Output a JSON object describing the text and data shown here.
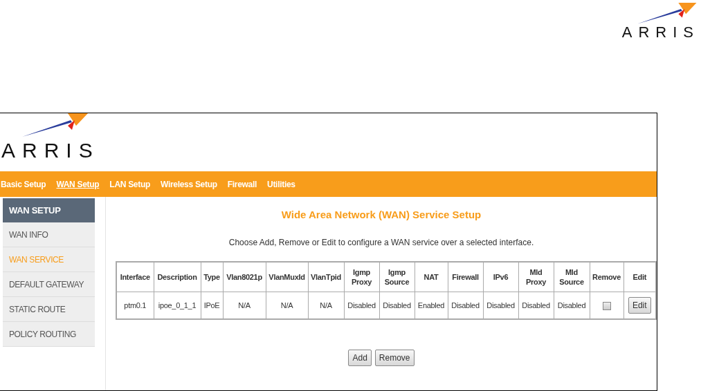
{
  "document_header": {
    "logo_text": "ARRIS"
  },
  "app_header": {
    "logo_text": "ARRIS"
  },
  "nav": [
    {
      "label": "Basic Setup",
      "selected": false
    },
    {
      "label": "WAN Setup",
      "selected": true
    },
    {
      "label": "LAN Setup",
      "selected": false
    },
    {
      "label": "Wireless Setup",
      "selected": false
    },
    {
      "label": "Firewall",
      "selected": false
    },
    {
      "label": "Utilities",
      "selected": false
    }
  ],
  "sidebar": {
    "title": "WAN SETUP",
    "items": [
      {
        "label": "WAN INFO",
        "selected": false
      },
      {
        "label": "WAN SERVICE",
        "selected": true
      },
      {
        "label": "DEFAULT GATEWAY",
        "selected": false
      },
      {
        "label": "STATIC ROUTE",
        "selected": false
      },
      {
        "label": "POLICY ROUTING",
        "selected": false
      }
    ]
  },
  "main": {
    "title": "Wide Area Network (WAN) Service Setup",
    "description": "Choose Add, Remove or Edit to configure a WAN service over a selected interface."
  },
  "table": {
    "columns": [
      "Interface",
      "Description",
      "Type",
      "Vlan8021p",
      "VlanMuxId",
      "VlanTpid",
      "Igmp Proxy",
      "Igmp Source",
      "NAT",
      "Firewall",
      "IPv6",
      "Mld Proxy",
      "Mld Source",
      "Remove",
      "Edit"
    ],
    "rows": [
      {
        "cells": [
          "ptm0.1",
          "ipoe_0_1_1",
          "IPoE",
          "N/A",
          "N/A",
          "N/A",
          "Disabled",
          "Disabled",
          "Enabled",
          "Disabled",
          "Disabled",
          "Disabled",
          "Disabled"
        ],
        "remove_checked": false,
        "edit_button": "Edit"
      }
    ]
  },
  "buttons": [
    "Add",
    "Remove"
  ]
}
